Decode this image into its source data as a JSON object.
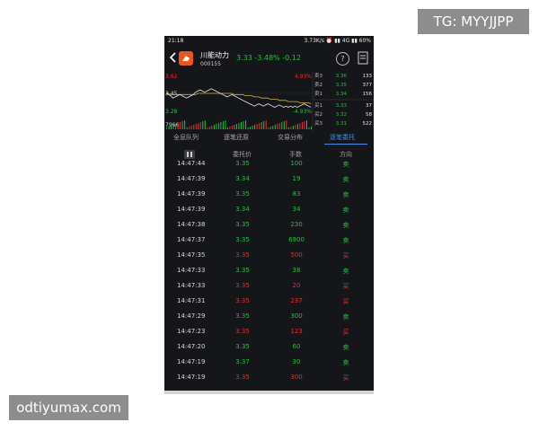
{
  "watermarks": {
    "top_right": "TG: MYYJJPP",
    "bottom_left": "odtiyumax.com"
  },
  "status_bar": {
    "time": "21:18",
    "right": "3.73K/s ⏰ ▮▮ 4G ▮▮ 60%"
  },
  "header": {
    "stock_name": "川能动力",
    "stock_code": "000155",
    "price_line": "3.33  -3.48%  -0.12",
    "help": "?"
  },
  "chart": {
    "high_label": "3.62",
    "mid_label": "3.45",
    "low_label": "3.28",
    "vol_label": "7966",
    "pct_up": "4.93%",
    "pct_down": "-4.93%",
    "price_color_up": "#e4312f",
    "price_color_down": "#22c33a",
    "line_color": "#e8e8e8",
    "avg_color": "#d9b43a",
    "price_series": [
      3.45,
      3.44,
      3.43,
      3.41,
      3.42,
      3.43,
      3.44,
      3.43,
      3.42,
      3.41,
      3.42,
      3.43,
      3.44,
      3.46,
      3.47,
      3.48,
      3.47,
      3.46,
      3.47,
      3.48,
      3.49,
      3.48,
      3.47,
      3.46,
      3.45,
      3.44,
      3.43,
      3.42,
      3.43,
      3.44,
      3.43,
      3.42,
      3.41,
      3.4,
      3.39,
      3.38,
      3.37,
      3.36,
      3.35,
      3.34,
      3.35,
      3.36,
      3.35,
      3.34,
      3.35,
      3.36,
      3.35,
      3.34,
      3.33,
      3.34,
      3.35,
      3.34,
      3.33,
      3.34,
      3.33,
      3.34,
      3.33,
      3.34,
      3.33,
      3.34,
      3.35,
      3.36,
      3.35,
      3.34,
      3.33
    ],
    "avg_series": [
      3.45,
      3.45,
      3.44,
      3.44,
      3.44,
      3.44,
      3.44,
      3.44,
      3.44,
      3.44,
      3.44,
      3.44,
      3.44,
      3.44,
      3.45,
      3.45,
      3.45,
      3.45,
      3.45,
      3.45,
      3.45,
      3.45,
      3.45,
      3.45,
      3.45,
      3.45,
      3.45,
      3.45,
      3.45,
      3.45,
      3.44,
      3.44,
      3.44,
      3.44,
      3.44,
      3.43,
      3.43,
      3.43,
      3.43,
      3.42,
      3.42,
      3.42,
      3.41,
      3.41,
      3.41,
      3.41,
      3.4,
      3.4,
      3.4,
      3.4,
      3.39,
      3.39,
      3.39,
      3.39,
      3.38,
      3.38,
      3.38,
      3.38,
      3.38,
      3.37,
      3.37,
      3.37,
      3.37,
      3.37,
      3.36
    ],
    "order_book": [
      {
        "label": "卖3",
        "price": "3.36",
        "vol": "133"
      },
      {
        "label": "卖2",
        "price": "3.35",
        "vol": "377"
      },
      {
        "label": "卖1",
        "price": "3.34",
        "vol": "156"
      },
      {
        "label": "买1",
        "price": "3.33",
        "vol": "37"
      },
      {
        "label": "买2",
        "price": "3.32",
        "vol": "58"
      },
      {
        "label": "买3",
        "price": "3.31",
        "vol": "522"
      }
    ]
  },
  "tabs": [
    {
      "label": "全息队列",
      "active": false
    },
    {
      "label": "逐笔还原",
      "active": false
    },
    {
      "label": "交易分布",
      "active": false
    },
    {
      "label": "逐笔委托",
      "active": true
    }
  ],
  "table": {
    "headers": {
      "price": "委托价",
      "qty": "手数",
      "dir": "方向"
    },
    "rows": [
      {
        "time": "14:47:44",
        "price": "3.35",
        "qty": "100",
        "dir": "卖",
        "color": "g"
      },
      {
        "time": "14:47:39",
        "price": "3.34",
        "qty": "19",
        "dir": "卖",
        "color": "g"
      },
      {
        "time": "14:47:39",
        "price": "3.35",
        "qty": "83",
        "dir": "卖",
        "color": "g"
      },
      {
        "time": "14:47:39",
        "price": "3.34",
        "qty": "34",
        "dir": "卖",
        "color": "g"
      },
      {
        "time": "14:47:38",
        "price": "3.35",
        "qty": "230",
        "dir": "卖",
        "color": "g"
      },
      {
        "time": "14:47:37",
        "price": "3.35",
        "qty": "6900",
        "dir": "卖",
        "color": "g"
      },
      {
        "time": "14:47:35",
        "price": "3.35",
        "qty": "500",
        "dir": "买",
        "color": "r"
      },
      {
        "time": "14:47:33",
        "price": "3.35",
        "qty": "38",
        "dir": "卖",
        "color": "g"
      },
      {
        "time": "14:47:33",
        "price": "3.35",
        "qty": "20",
        "dir": "买",
        "color": "r"
      },
      {
        "time": "14:47:31",
        "price": "3.35",
        "qty": "237",
        "dir": "买",
        "color": "r"
      },
      {
        "time": "14:47:29",
        "price": "3.35",
        "qty": "300",
        "dir": "卖",
        "color": "g"
      },
      {
        "time": "14:47:23",
        "price": "3.35",
        "qty": "123",
        "dir": "买",
        "color": "r"
      },
      {
        "time": "14:47:20",
        "price": "3.35",
        "qty": "60",
        "dir": "卖",
        "color": "g"
      },
      {
        "time": "14:47:19",
        "price": "3.37",
        "qty": "30",
        "dir": "卖",
        "color": "g"
      },
      {
        "time": "14:47:19",
        "price": "3.35",
        "qty": "300",
        "dir": "买",
        "color": "r"
      }
    ]
  }
}
